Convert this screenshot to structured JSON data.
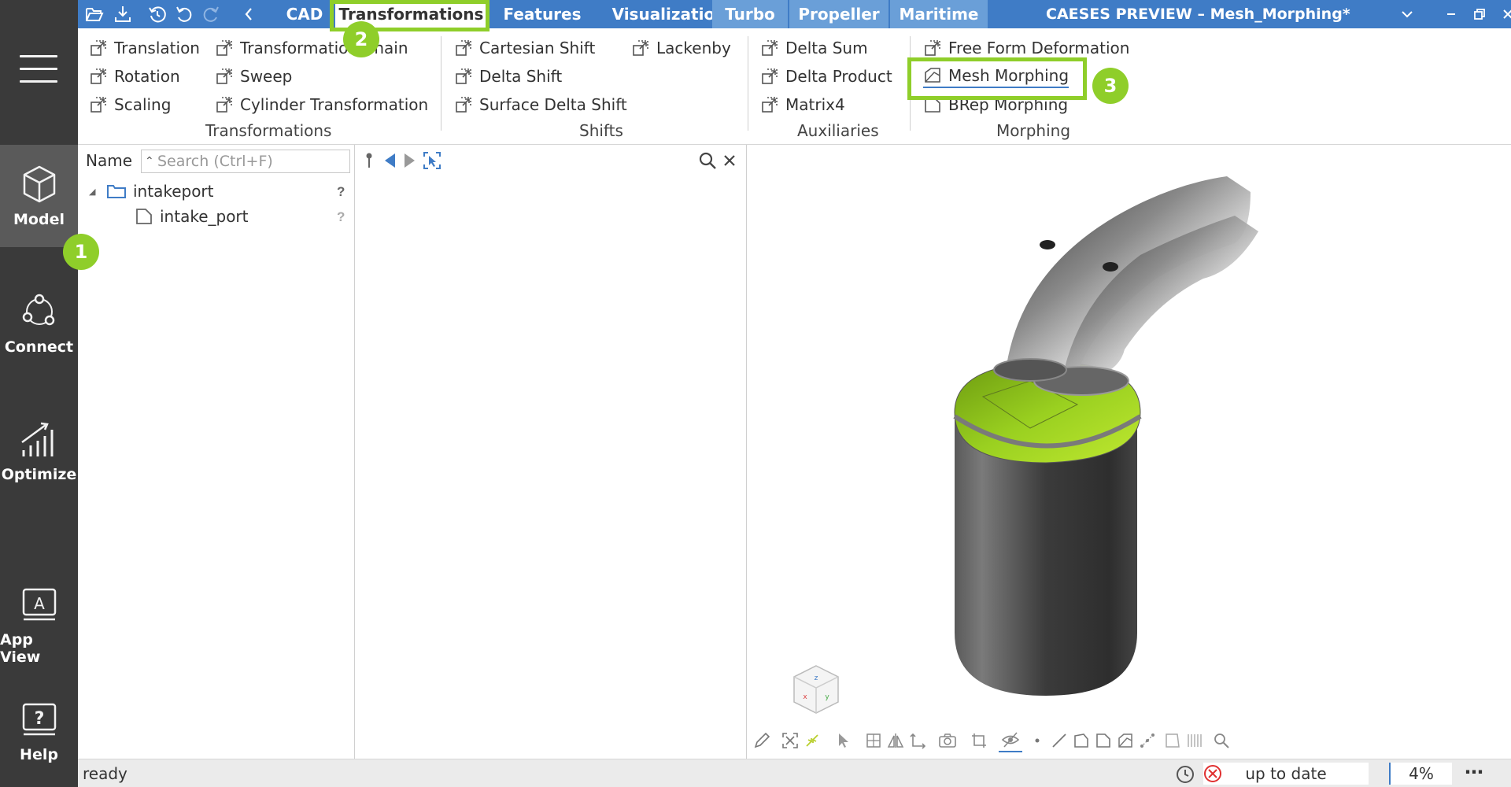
{
  "window": {
    "title": "CAESES PREVIEW  –  Mesh_Morphing*"
  },
  "sidebar": {
    "items": [
      {
        "label": "Model",
        "icon": "cube-icon",
        "active": true
      },
      {
        "label": "Connect",
        "icon": "connect-nodes-icon"
      },
      {
        "label": "Optimize",
        "icon": "chart-bars-icon"
      },
      {
        "label": "App View",
        "icon": "app-view-icon"
      },
      {
        "label": "Help",
        "icon": "help-icon"
      }
    ]
  },
  "menu_tabs": [
    {
      "label": "CAD"
    },
    {
      "label": "Transformations",
      "active": true
    },
    {
      "label": "Features"
    },
    {
      "label": "Visualization"
    },
    {
      "label": "Turbo",
      "style": "light"
    },
    {
      "label": "Propeller",
      "style": "light"
    },
    {
      "label": "Maritime",
      "style": "light"
    }
  ],
  "ribbon": {
    "groups": [
      {
        "label": "Transformations",
        "items": [
          "Translation",
          "Rotation",
          "Scaling",
          "Transformation Chain",
          "Sweep",
          "Cylinder Transformation"
        ]
      },
      {
        "label": "Shifts",
        "items": [
          "Cartesian Shift",
          "Delta Shift",
          "Surface Delta Shift",
          "Lackenby"
        ]
      },
      {
        "label": "Auxiliaries",
        "items": [
          "Delta Sum",
          "Delta Product",
          "Matrix4"
        ]
      },
      {
        "label": "Morphing",
        "items": [
          "Free Form Deformation",
          "Mesh Morphing",
          "BRep Morphing"
        ]
      }
    ]
  },
  "callouts": [
    "1",
    "2",
    "3"
  ],
  "tree": {
    "header": "Name",
    "search_placeholder": "Search (Ctrl+F)",
    "nodes": [
      {
        "label": "intakeport",
        "qmark": "?"
      },
      {
        "label": "intake_port",
        "qmark": "?"
      }
    ]
  },
  "status": {
    "text": "ready",
    "sync": "up to date",
    "zoom": "4%"
  },
  "colors": {
    "accent_blue": "#3f7cc6",
    "highlight_green": "#8fce2a",
    "sidebar_dark": "#3a3a3a"
  }
}
